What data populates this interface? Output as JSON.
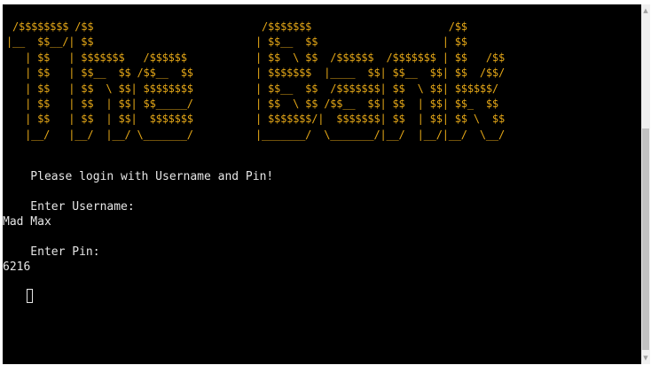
{
  "terminal": {
    "banner_lines": [
      " /$$$$$$$$ /$$                           /$$$$$$$                      /$$",
      "|__  $$__/| $$                          | $$__  $$                    | $$",
      "   | $$   | $$$$$$$   /$$$$$$           | $$  \\ $$  /$$$$$$  /$$$$$$$ | $$   /$$",
      "   | $$   | $$__  $$ /$$__  $$          | $$$$$$$  |____  $$| $$__  $$| $$  /$$/",
      "   | $$   | $$  \\ $$| $$$$$$$$          | $$__  $$  /$$$$$$$| $$  \\ $$| $$$$$$/",
      "   | $$   | $$  | $$| $$_____/          | $$  \\ $$ /$$__  $$| $$  | $$| $$_  $$",
      "   | $$   | $$  | $$|  $$$$$$$          | $$$$$$$/|  $$$$$$$| $$  | $$| $$ \\  $$",
      "   |__/   |__/  |__/ \\_______/          |_______/  \\_______/|__/  |__/|__/  \\__/"
    ],
    "prompt_message": "    Please login with Username and Pin!",
    "username_prompt": "    Enter Username:",
    "username_value": "Mad Max",
    "pin_prompt": "    Enter Pin:",
    "pin_value": "6216"
  },
  "colors": {
    "banner": "#e6a817",
    "text": "#e6e6e6",
    "background": "#000000"
  }
}
